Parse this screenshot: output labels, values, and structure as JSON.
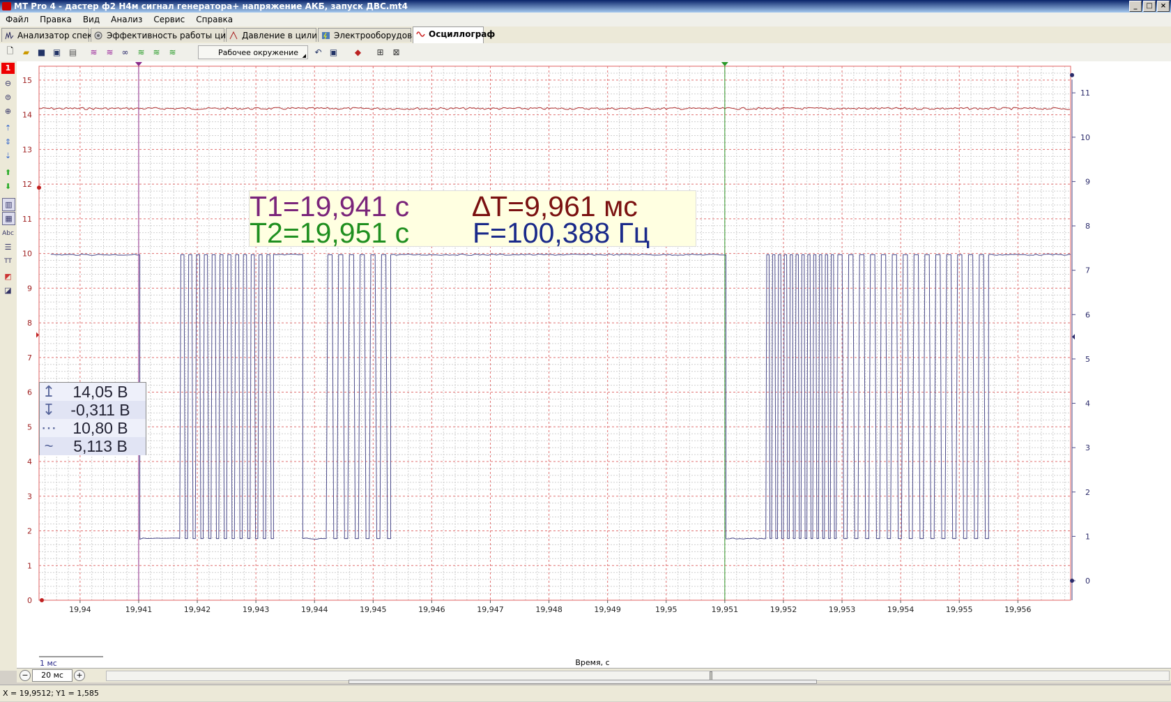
{
  "window": {
    "title": "MT Pro 4 - дастер ф2 Н4м сигнал генератора+ напряжение АКБ, запуск ДВС.mt4"
  },
  "menu": [
    "Файл",
    "Правка",
    "Вид",
    "Анализ",
    "Сервис",
    "Справка"
  ],
  "tabs": [
    {
      "label": "Анализатор спектра",
      "icon": "spectrum-icon"
    },
    {
      "label": "Эффективность работы цилиндров",
      "icon": "cylinder-efficiency-icon"
    },
    {
      "label": "Давление в цилиндре",
      "icon": "pressure-icon"
    },
    {
      "label": "Электрооборудование",
      "icon": "electrical-icon"
    },
    {
      "label": "Осциллограф",
      "icon": "oscilloscope-icon",
      "active": true
    }
  ],
  "toolbar": {
    "workspace_label": "Рабочее окружение"
  },
  "left_toolbar": {
    "channel_number": "1"
  },
  "cursor_info": {
    "t1": "T1=19,941 с",
    "t2": "T2=19,951 с",
    "dt": "∆T=9,961 мс",
    "freq": "F=100,388 Гц"
  },
  "measurements": [
    {
      "icon": "max-arrow-icon",
      "value": "14,05 В"
    },
    {
      "icon": "min-arrow-icon",
      "value": "-0,311 В"
    },
    {
      "icon": "average-icon",
      "value": "10,80 В"
    },
    {
      "icon": "rms-icon",
      "value": "5,113 В"
    }
  ],
  "chart_data": {
    "type": "line",
    "xlabel": "Время, с",
    "xlim": [
      19.9393,
      19.9569
    ],
    "x_ticks": [
      "19,94",
      "19,941",
      "19,942",
      "19,943",
      "19,944",
      "19,945",
      "19,946",
      "19,947",
      "19,948",
      "19,949",
      "19,95",
      "19,951",
      "19,952",
      "19,953",
      "19,954",
      "19,955",
      "19,956"
    ],
    "x_tick_values": [
      19.94,
      19.941,
      19.942,
      19.943,
      19.944,
      19.945,
      19.946,
      19.947,
      19.948,
      19.949,
      19.95,
      19.951,
      19.952,
      19.953,
      19.954,
      19.955,
      19.956
    ],
    "ylim_left": [
      0,
      15.4
    ],
    "y_ticks_left": [
      "0",
      "1",
      "2",
      "3",
      "4",
      "5",
      "6",
      "7",
      "8",
      "9",
      "10",
      "11",
      "12",
      "13",
      "14",
      "15"
    ],
    "ylim_right": [
      -0.44,
      11.6
    ],
    "y_ticks_right": [
      "0",
      "1",
      "2",
      "3",
      "4",
      "5",
      "6",
      "7",
      "8",
      "9",
      "10",
      "11"
    ],
    "grid": true,
    "scale_label": "1 мс",
    "cursors": [
      {
        "name": "T1",
        "x": 19.941,
        "color": "#8a2a8a"
      },
      {
        "name": "T2",
        "x": 19.951,
        "color": "#2a9a2a"
      }
    ],
    "series": [
      {
        "axis": "left",
        "color": "#b03030",
        "level": 14.18,
        "x": [
          19.9393,
          19.9569
        ]
      },
      {
        "axis": "right",
        "color": "#4a4a8a",
        "high": 7.35,
        "low": 0.95,
        "bursts": [
          {
            "start": 19.9395,
            "end": 19.94102,
            "state": "high"
          },
          {
            "start": 19.94102,
            "end": 19.9417,
            "state": "low"
          },
          {
            "start": 19.9417,
            "end": 19.9433,
            "state": "pulses",
            "count": 12
          },
          {
            "start": 19.9433,
            "end": 19.9438,
            "state": "high"
          },
          {
            "start": 19.9438,
            "end": 19.9442,
            "state": "low"
          },
          {
            "start": 19.9442,
            "end": 19.9453,
            "state": "pulses",
            "count": 6
          },
          {
            "start": 19.9453,
            "end": 19.95102,
            "state": "high"
          },
          {
            "start": 19.95102,
            "end": 19.9517,
            "state": "low"
          },
          {
            "start": 19.9517,
            "end": 19.9529,
            "state": "pulses",
            "count": 12
          },
          {
            "start": 19.9529,
            "end": 19.9555,
            "state": "pulses",
            "count": 14
          },
          {
            "start": 19.9555,
            "end": 19.9569,
            "state": "high"
          }
        ]
      }
    ]
  },
  "zoom": {
    "value": "20 мс"
  },
  "status": {
    "coords": "X = 19,9512; Y1 = 1,585"
  }
}
